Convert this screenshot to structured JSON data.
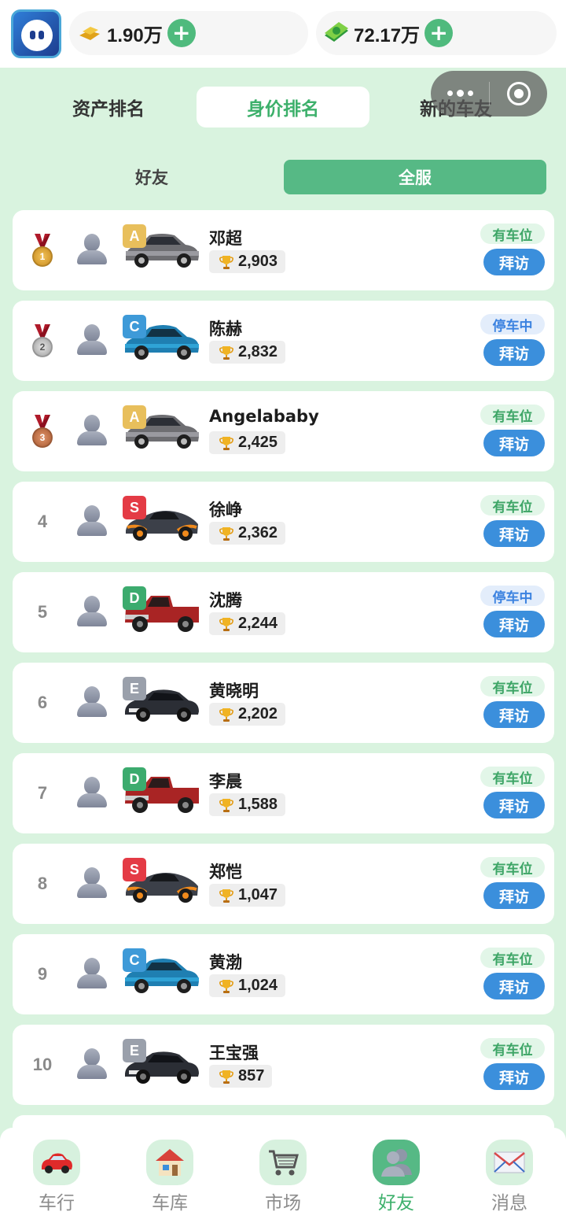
{
  "header": {
    "gold_value": "1.90万",
    "cash_value": "72.17万",
    "gold_icon": "gold-bars-icon",
    "cash_icon": "cash-stack-icon"
  },
  "rank_tabs": [
    "资产排名",
    "身价排名",
    "新的车友"
  ],
  "active_rank_tab": "身价排名",
  "scope_tabs": [
    "好友",
    "全服"
  ],
  "active_scope_tab": "全服",
  "colors": {
    "accent_green": "#56b985",
    "visit_blue": "#3b8fdc",
    "grade_A": "#e8bf5c",
    "grade_C": "#3e9ad8",
    "grade_S": "#e43b45",
    "grade_D": "#3cab6e",
    "grade_E": "#9aa0ab"
  },
  "visit_label": "拜访",
  "rows": [
    {
      "rank": "1",
      "medal": "gold",
      "grade": "A",
      "car": "silver-sedan",
      "name": "邓超",
      "score": "2,903",
      "status": "有车位",
      "status_type": "free"
    },
    {
      "rank": "2",
      "medal": "silver",
      "grade": "C",
      "car": "blue-sedan",
      "name": "陈赫",
      "score": "2,832",
      "status": "停车中",
      "status_type": "parked"
    },
    {
      "rank": "3",
      "medal": "bronze",
      "grade": "A",
      "car": "silver-sedan",
      "name": "Angelababy",
      "score": "2,425",
      "status": "有车位",
      "status_type": "free"
    },
    {
      "rank": "4",
      "medal": "",
      "grade": "S",
      "car": "orange-supercar",
      "name": "徐峥",
      "score": "2,362",
      "status": "有车位",
      "status_type": "free"
    },
    {
      "rank": "5",
      "medal": "",
      "grade": "D",
      "car": "red-pickup",
      "name": "沈腾",
      "score": "2,244",
      "status": "停车中",
      "status_type": "parked"
    },
    {
      "rank": "6",
      "medal": "",
      "grade": "E",
      "car": "black-coupe",
      "name": "黄晓明",
      "score": "2,202",
      "status": "有车位",
      "status_type": "free"
    },
    {
      "rank": "7",
      "medal": "",
      "grade": "D",
      "car": "red-pickup",
      "name": "李晨",
      "score": "1,588",
      "status": "有车位",
      "status_type": "free"
    },
    {
      "rank": "8",
      "medal": "",
      "grade": "S",
      "car": "orange-supercar",
      "name": "郑恺",
      "score": "1,047",
      "status": "有车位",
      "status_type": "free"
    },
    {
      "rank": "9",
      "medal": "",
      "grade": "C",
      "car": "blue-sedan",
      "name": "黄渤",
      "score": "1,024",
      "status": "有车位",
      "status_type": "free"
    },
    {
      "rank": "10",
      "medal": "",
      "grade": "E",
      "car": "black-coupe",
      "name": "王宝强",
      "score": "857",
      "status": "有车位",
      "status_type": "free"
    }
  ],
  "nav": [
    {
      "label": "车行",
      "icon": "car-icon"
    },
    {
      "label": "车库",
      "icon": "garage-house-icon"
    },
    {
      "label": "市场",
      "icon": "shopping-cart-icon"
    },
    {
      "label": "好友",
      "icon": "friends-icon"
    },
    {
      "label": "消息",
      "icon": "envelope-icon"
    }
  ],
  "active_nav": "好友"
}
